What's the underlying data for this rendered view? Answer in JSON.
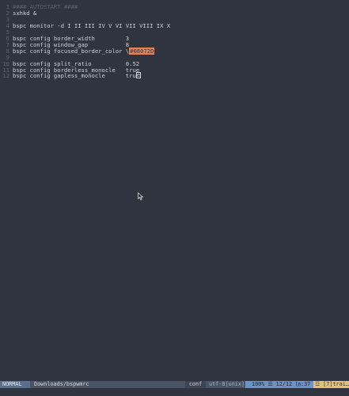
{
  "editor": {
    "lines": [
      {
        "num": "1",
        "parts": [
          {
            "t": "#### AUTOSTART ####",
            "c": "comment"
          }
        ]
      },
      {
        "num": "2",
        "parts": [
          {
            "t": "sxhkd &"
          }
        ]
      },
      {
        "num": "3",
        "parts": [
          {
            "t": ""
          }
        ]
      },
      {
        "num": "4",
        "parts": [
          {
            "t": "bspc monitor -d I II III IV V VI VII VIII IX X"
          }
        ]
      },
      {
        "num": "5",
        "parts": [
          {
            "t": ""
          }
        ]
      },
      {
        "num": "6",
        "parts": [
          {
            "t": "bspc config border_width         3"
          }
        ]
      },
      {
        "num": "7",
        "parts": [
          {
            "t": "bspc config window_gap           8"
          }
        ]
      },
      {
        "num": "8",
        "parts": [
          {
            "t": "bspc config focused_border_color \\"
          },
          {
            "t": "#08072D",
            "c": "color-hl"
          }
        ]
      },
      {
        "num": "9",
        "parts": [
          {
            "t": ""
          }
        ]
      },
      {
        "num": "10",
        "parts": [
          {
            "t": "bspc config split_ratio          0.52"
          }
        ]
      },
      {
        "num": "11",
        "parts": [
          {
            "t": "bspc config borderless_monocle   true"
          }
        ]
      },
      {
        "num": "12",
        "parts": [
          {
            "t": "bspc config gapless_monocle      tru"
          },
          {
            "t": "e",
            "c": "cursor"
          }
        ]
      }
    ]
  },
  "statusbar": {
    "mode": "NORMAL",
    "path": "Downloads/bspwmrc",
    "filetype": "conf",
    "encoding": "utf-8[unix]",
    "position": "100% ☰ 12/12 ㏑:37",
    "warning": "☲ [7]trai…"
  },
  "colors": {
    "background": "#2f343f",
    "mode_bg": "#5a6f8e",
    "position_bg": "#6b93c8",
    "warning_bg": "#e5c07b",
    "color_highlight": "#e0855a"
  }
}
